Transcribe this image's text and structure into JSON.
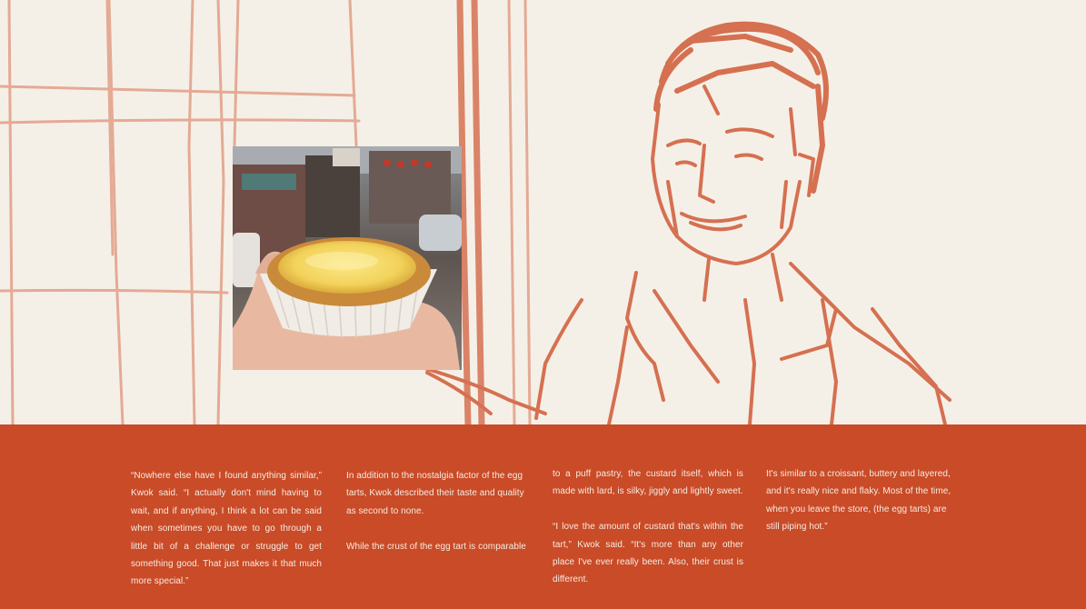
{
  "colors": {
    "paper": "#f5f0e7",
    "crayon": "#d05a38",
    "panel": "#c94b27",
    "panel_text": "#f6ebe3"
  },
  "illustration": {
    "subject": "crayon-sketch-portrait-icon",
    "photo": "egg-tart-in-hand-photo"
  },
  "article": {
    "col1": {
      "p1": "“Nowhere else have I found anything similar,” Kwok said. “I actually don't mind having to wait, and if anything, I think a lot can be said when sometimes you have to go through a little bit of a challenge or struggle to get something good. That just makes it that much more special.”"
    },
    "col2": {
      "p1": "In addition to the nostalgia factor of the egg tarts, Kwok described their taste and quality as second to none.",
      "p2": "While the crust of the egg tart is comparable"
    },
    "col3": {
      "p1": "to a puff pastry, the custard itself, which is made with lard, is silky, jiggly and lightly sweet.",
      "p2": "“I love the amount of custard that's within the tart,” Kwok said. “It's more than any other place I've ever really been. Also, their crust is different."
    },
    "col4": {
      "p1": "It's similar to a croissant, buttery and layered, and it's really nice and flaky. Most of the time, when you leave the store, (the egg tarts) are still piping hot.”"
    }
  }
}
